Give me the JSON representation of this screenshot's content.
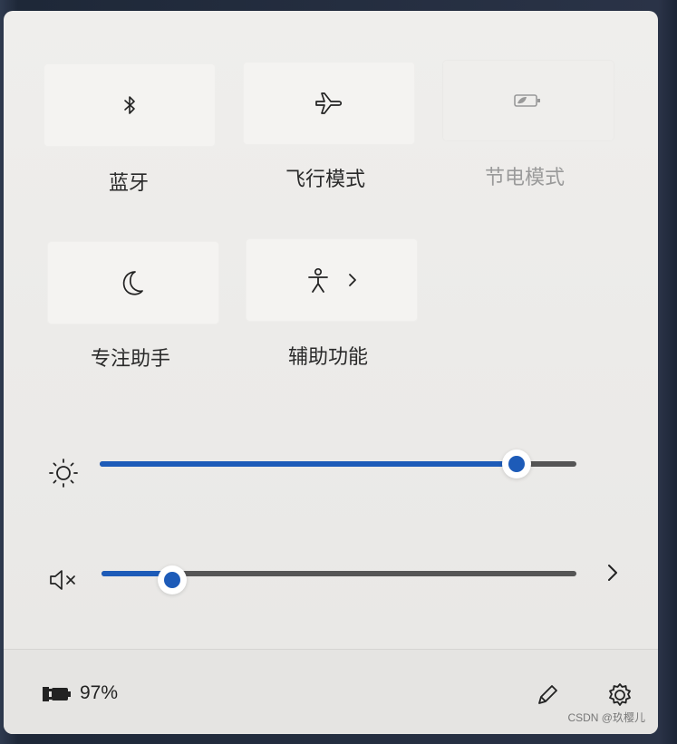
{
  "quick_settings": {
    "tiles": [
      {
        "label": "蓝牙",
        "icon": "bluetooth-icon",
        "enabled": true
      },
      {
        "label": "飞行模式",
        "icon": "airplane-icon",
        "enabled": true
      },
      {
        "label": "节电模式",
        "icon": "battery-saver-icon",
        "enabled": false
      },
      {
        "label": "专注助手",
        "icon": "moon-icon",
        "enabled": true
      },
      {
        "label": "辅助功能",
        "icon": "accessibility-icon",
        "enabled": true,
        "has_submenu": true
      }
    ]
  },
  "sliders": {
    "brightness": {
      "icon": "brightness-icon",
      "value": 0.87
    },
    "volume": {
      "icon": "volume-muted-icon",
      "value": 0.15,
      "has_submenu": true
    }
  },
  "footer": {
    "battery_percent": "97%",
    "battery_icon": "battery-charging-icon",
    "edit_icon": "pencil-icon",
    "settings_icon": "gear-icon"
  },
  "watermark": "CSDN @玖樱儿",
  "colors": {
    "accent": "#1d5bb8",
    "panel_bg": "#eeedeb",
    "tile_bg": "#f4f3f1"
  }
}
